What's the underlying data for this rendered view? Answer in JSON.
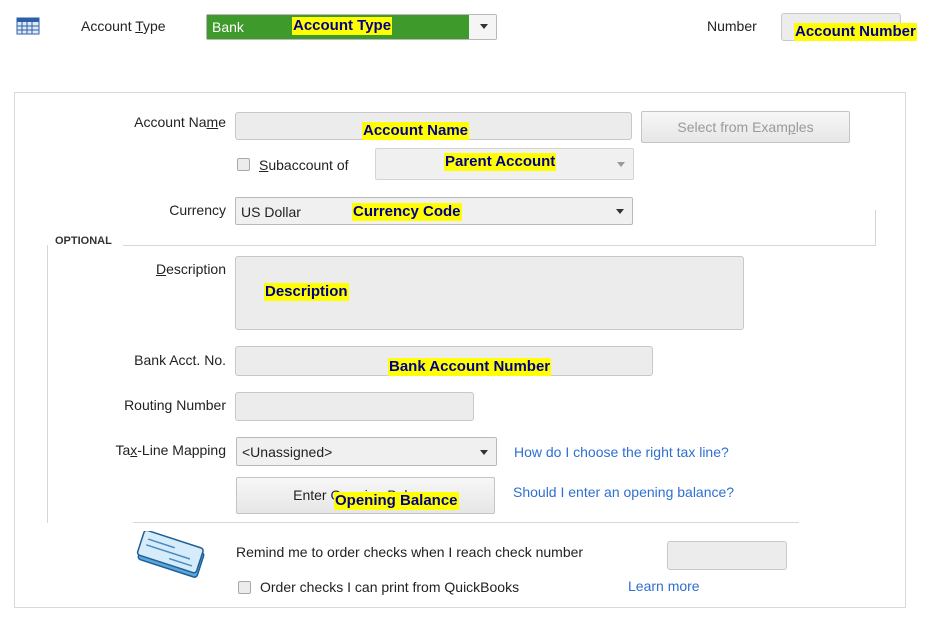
{
  "header": {
    "account_type_label_pre": "Account ",
    "account_type_label_ul": "T",
    "account_type_label_post": "ype",
    "account_type_value": "Bank",
    "account_type_overlay": "Account Type",
    "number_label": "Number",
    "number_overlay": "Account Number"
  },
  "account_name": {
    "label_pre": "Account Na",
    "label_ul": "m",
    "label_post": "e",
    "overlay": "Account Name",
    "examples_button_pre": "Select from Exam",
    "examples_button_ul": "p",
    "examples_button_post": "les"
  },
  "subaccount": {
    "label_ul": "S",
    "label_post": "ubaccount of",
    "overlay": "Parent Account"
  },
  "currency": {
    "label": "Currency",
    "value": "US Dollar",
    "overlay": "Currency Code"
  },
  "optional": {
    "section_label": "OPTIONAL",
    "description_label_ul": "D",
    "description_label_post": "escription",
    "description_overlay": "Description",
    "bank_acct_label": "Bank Acct. No.",
    "bank_acct_overlay": "Bank Account Number",
    "routing_label": "Routing Number",
    "taxline_label_pre": "Ta",
    "taxline_label_ul": "x",
    "taxline_label_post": "-Line Mapping",
    "taxline_value": "<Unassigned>",
    "taxline_help_link": "How do I choose the right tax line?",
    "opening_button_label": "Enter Opening Balance",
    "opening_overlay": "Opening Balance",
    "opening_help_link": "Should I enter an opening balance?"
  },
  "checks": {
    "remind_label": "Remind me to order checks when I reach check number",
    "order_checks_label": "Order checks I can print from QuickBooks",
    "learn_more_link": "Learn more"
  },
  "icons": [
    "account-table-icon",
    "check-icon"
  ],
  "colors": {
    "account_type_bg": "#3e9a2a",
    "overlay_bg": "#ffff00",
    "overlay_text": "#00008b",
    "link": "#2f6fd1"
  }
}
